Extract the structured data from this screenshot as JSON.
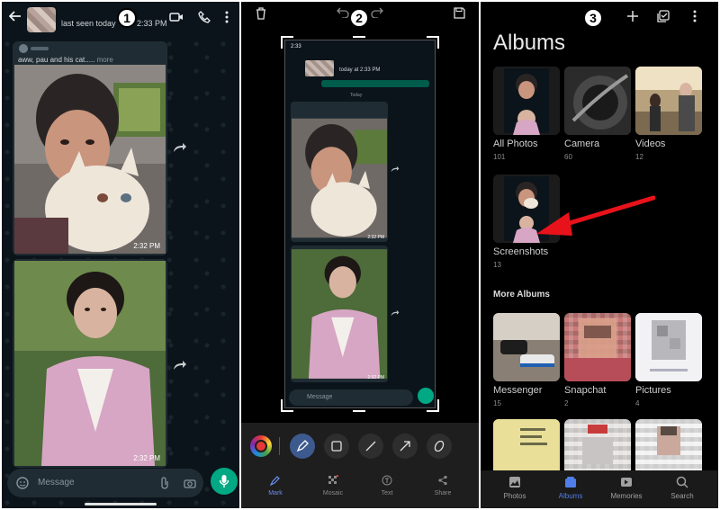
{
  "steps": [
    "1",
    "2",
    "3"
  ],
  "chat": {
    "status": "last seen today",
    "status_time": "2:33 PM",
    "quoted_text": "aww, pau and his cat.....",
    "quoted_more": "more",
    "photo1_time": "2:32 PM",
    "photo2_time": "2:32 PM",
    "input_placeholder": "Message"
  },
  "editor": {
    "mini_status_time": "2:33",
    "mini_header_status": "today at 2:33 PM",
    "mini_today": "Today",
    "mini_time1": "2:32 PM",
    "mini_time2": "2:32 PM",
    "mini_placeholder": "Message",
    "tabs": [
      "Mark",
      "Mosaic",
      "Text",
      "Share"
    ],
    "active_tab": "Mark"
  },
  "albums": {
    "title": "Albums",
    "items": [
      {
        "name": "All Photos",
        "count": "101"
      },
      {
        "name": "Camera",
        "count": "60"
      },
      {
        "name": "Videos",
        "count": "12"
      },
      {
        "name": "Screenshots",
        "count": "13"
      }
    ],
    "more_title": "More Albums",
    "more_items": [
      {
        "name": "Messenger",
        "count": "15"
      },
      {
        "name": "Snapchat",
        "count": "2"
      },
      {
        "name": "Pictures",
        "count": "4"
      }
    ],
    "nav": [
      "Photos",
      "Albums",
      "Memories",
      "Search"
    ],
    "active_nav": "Albums"
  },
  "colors": {
    "whatsapp_green": "#00a884",
    "accent_blue": "#4f7de9",
    "arrow_red": "#e8121b"
  }
}
